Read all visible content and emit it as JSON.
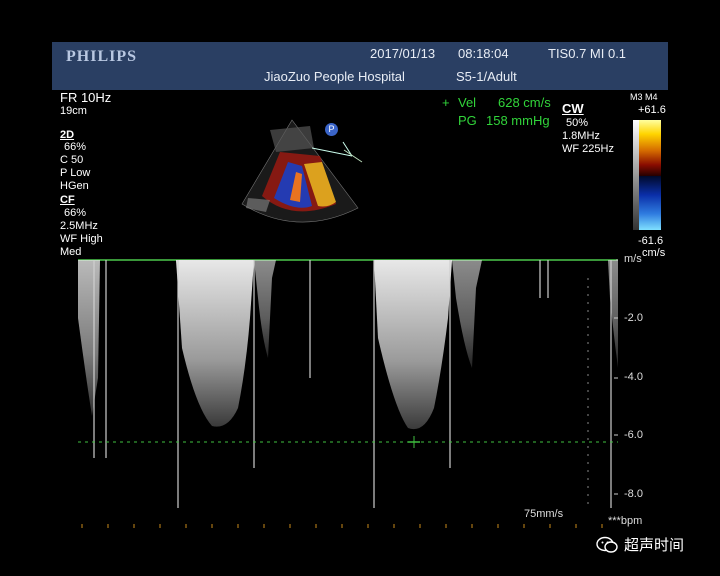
{
  "header": {
    "brand": "PHILIPS",
    "date": "2017/01/13",
    "time": "08:18:04",
    "tis_mi": "TIS0.7   MI 0.1",
    "hospital": "JiaoZuo  People Hospital",
    "probe": "S5-1/Adult"
  },
  "left_params": {
    "fr": "FR 10Hz",
    "depth": "19cm",
    "mode_2d": "2D",
    "gain_2d": "66%",
    "c": "C 50",
    "p": "P Low",
    "hgen": "HGen",
    "mode_cf": "CF",
    "gain_cf": "66%",
    "freq_cf": "2.5MHz",
    "wf": "WF High",
    "med": "Med"
  },
  "measurement": {
    "vel_label": "Vel",
    "vel_value": "628 cm/s",
    "pg_label": "PG",
    "pg_value": "158 mmHg"
  },
  "cw_params": {
    "mode": "CW",
    "gain": "50%",
    "freq": "1.8MHz",
    "wf": "WF 225Hz"
  },
  "color_scale": {
    "map": "M3 M4",
    "max": "+61.6",
    "min": "-61.6",
    "unit": "cm/s"
  },
  "doppler_scale": {
    "unit": "m/s",
    "ticks": [
      "-2.0",
      "-4.0",
      "-6.0",
      "-8.0"
    ],
    "sweep": "75mm/s",
    "hr": "***bpm"
  },
  "watermark": "超声时间",
  "colors": {
    "header_bg": "#2a3f63",
    "measure": "#31d43a",
    "baseline": "#4cc94c"
  }
}
